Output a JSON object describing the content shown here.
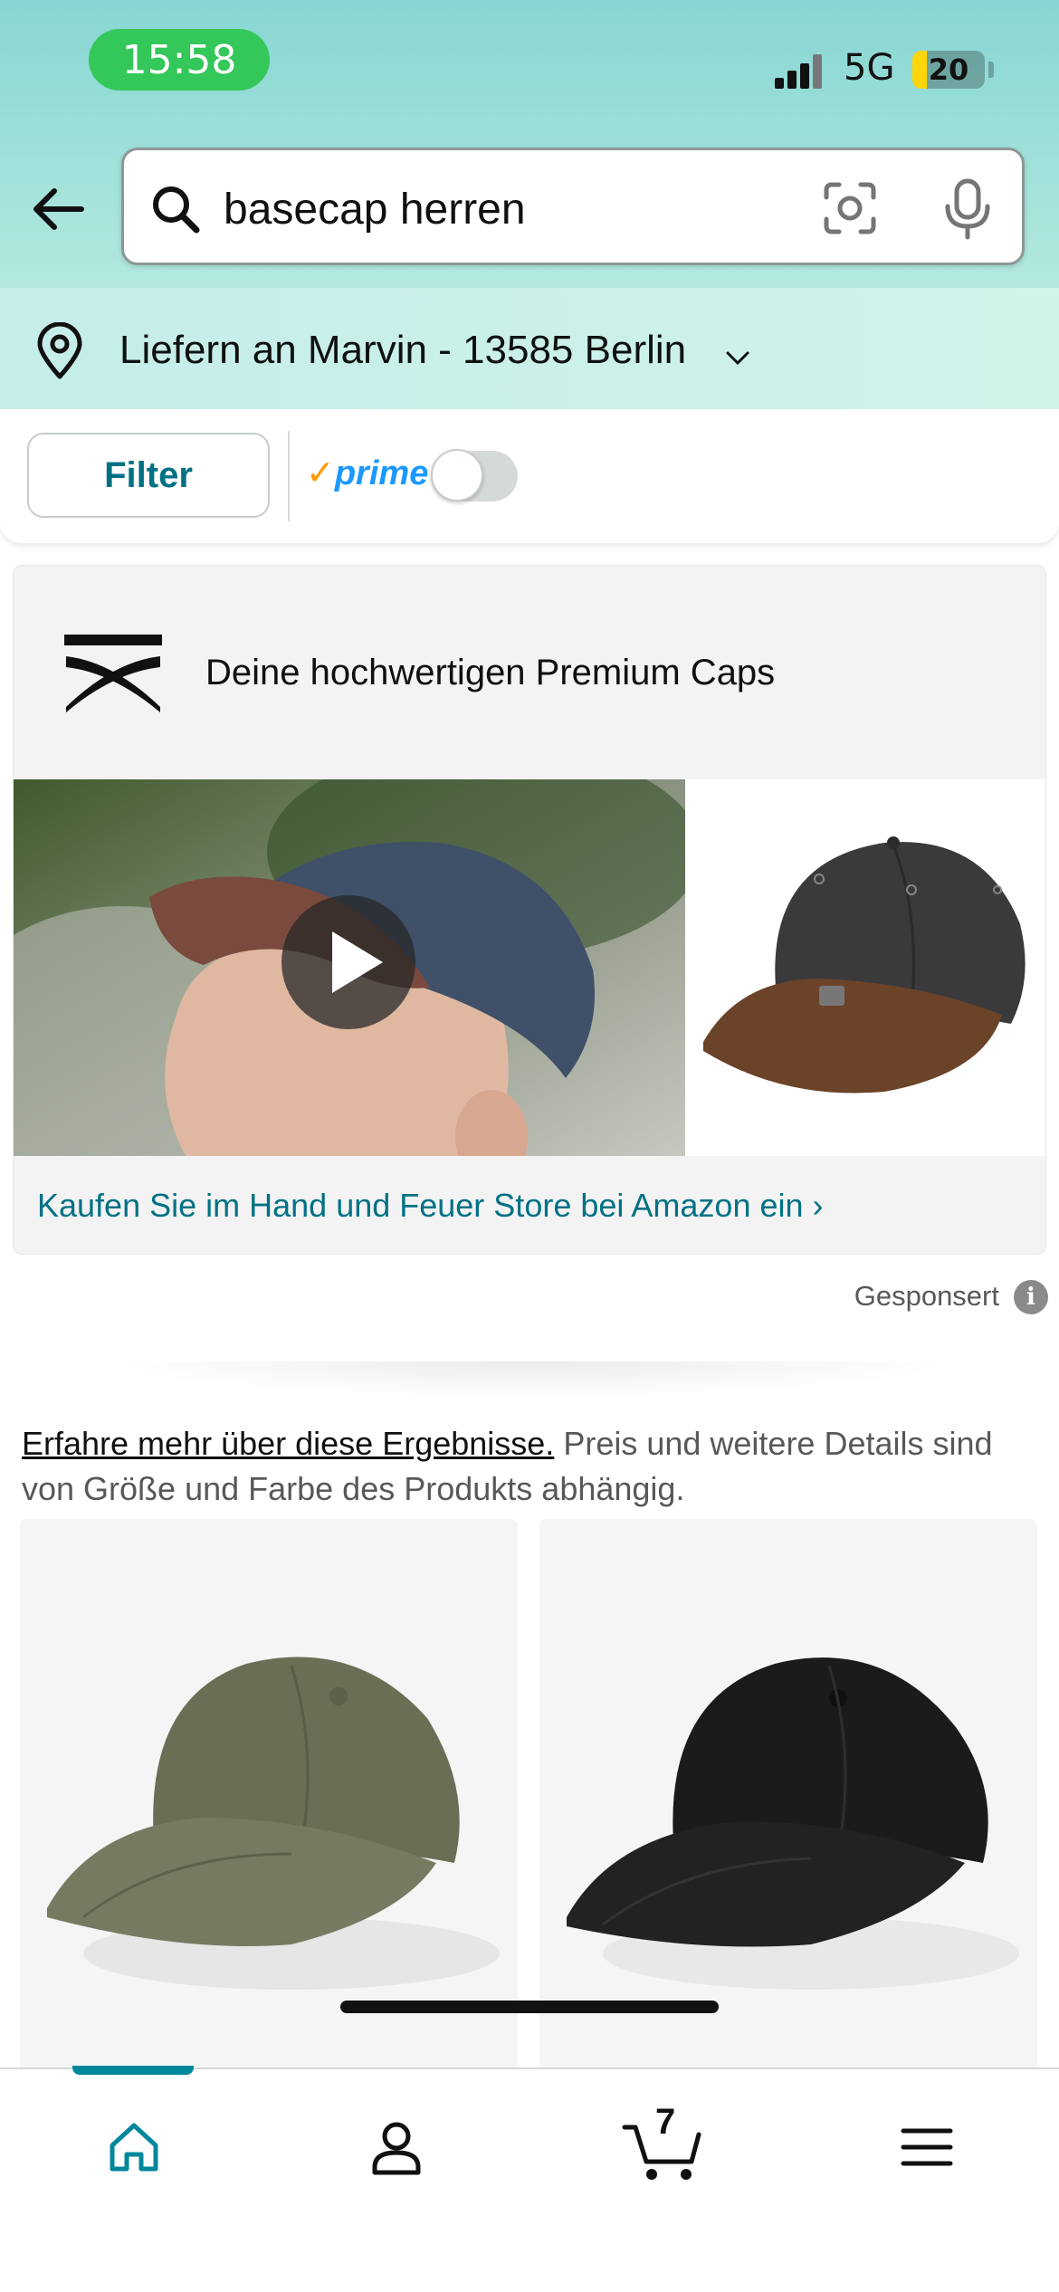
{
  "status_bar": {
    "time": "15:58",
    "network": "5G",
    "battery": "20",
    "battery_level": 0.2
  },
  "search": {
    "query": "basecap herren",
    "back_icon": "arrow-left-icon",
    "search_icon": "magnifier-icon",
    "camera_icon": "camera-scan-icon",
    "mic_icon": "microphone-icon"
  },
  "delivery": {
    "label": "Liefern an Marvin - 13585 Berlin"
  },
  "filters": {
    "filter_label": "Filter",
    "prime_label": "prime",
    "prime_toggle_on": false
  },
  "sponsored_brand": {
    "headline": "Deine hochwertigen Premium Caps",
    "store_link": "Kaufen Sie im Hand und Feuer Store bei Amazon ein ›",
    "sponsored_label": "Gesponsert",
    "info_icon": "i"
  },
  "results": {
    "link_text": "Erfahre mehr über diese Ergebnisse.",
    "info_text": " Preis und weitere Details sind von Größe und Farbe des Produkts abhängig.",
    "products": [
      {
        "color": "#6b6e55",
        "icon": "olive-cap-image"
      },
      {
        "color": "#1b1b1b",
        "icon": "black-cap-image"
      }
    ]
  },
  "bottom_nav": {
    "items": [
      {
        "name": "home",
        "icon": "home-icon",
        "active": true
      },
      {
        "name": "account",
        "icon": "person-icon",
        "active": false
      },
      {
        "name": "cart",
        "icon": "cart-icon",
        "active": false
      },
      {
        "name": "menu",
        "icon": "hamburger-menu-icon",
        "active": false
      }
    ],
    "cart_count": "7"
  },
  "colors": {
    "accent": "#007185",
    "active_nav": "#00879b",
    "header_top": "#87d6d3",
    "header_bottom": "#c5f0e6"
  }
}
